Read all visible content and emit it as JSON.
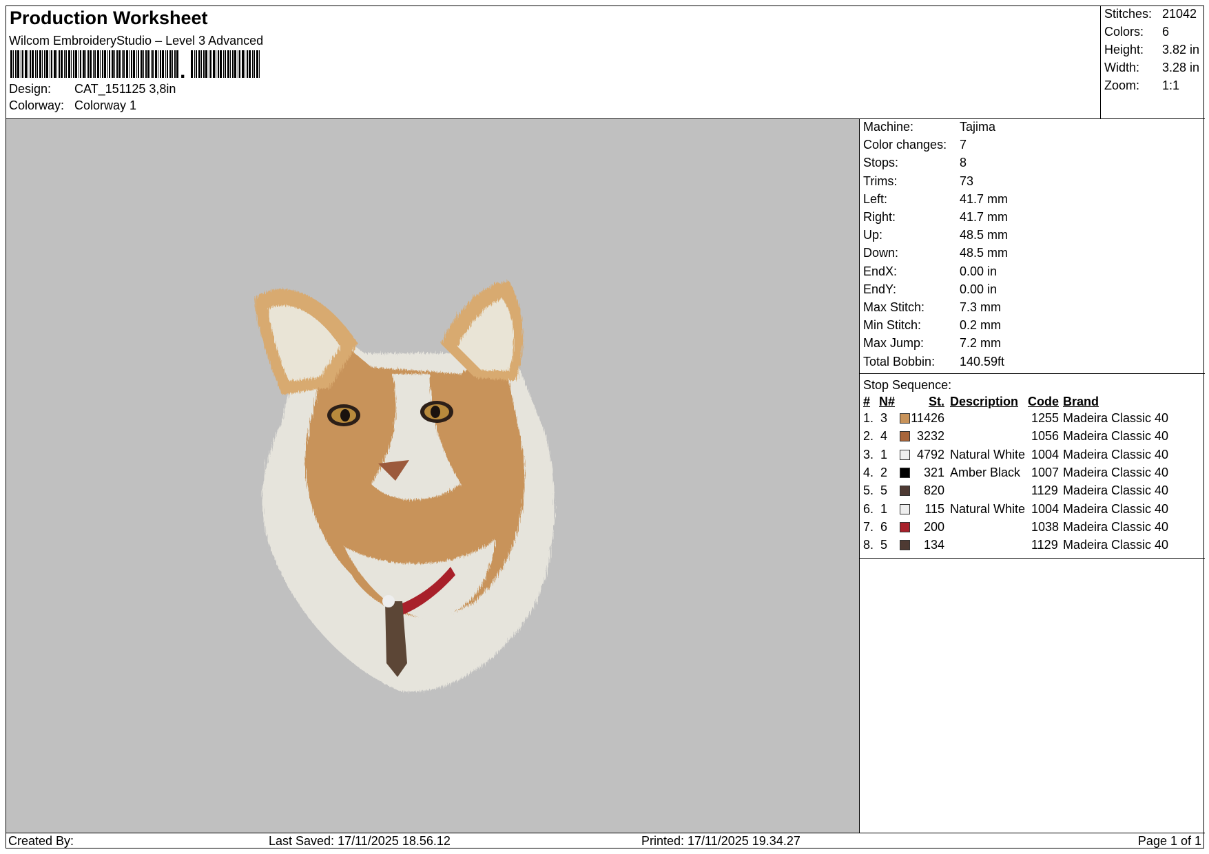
{
  "header": {
    "title": "Production Worksheet",
    "software": "Wilcom EmbroideryStudio – Level 3 Advanced",
    "barcode_text": ",",
    "design_label": "Design:",
    "design_value": "CAT_151125 3,8in",
    "colorway_label": "Colorway:",
    "colorway_value": "Colorway 1"
  },
  "stats": [
    {
      "label": "Stitches:",
      "value": "21042"
    },
    {
      "label": "Colors:",
      "value": "6"
    },
    {
      "label": "Height:",
      "value": "3.82 in"
    },
    {
      "label": "Width:",
      "value": "3.28 in"
    },
    {
      "label": "Zoom:",
      "value": "1:1"
    }
  ],
  "machine_info": [
    {
      "label": "Machine:",
      "value": "Tajima"
    },
    {
      "label": "Color changes:",
      "value": "7"
    },
    {
      "label": "Stops:",
      "value": "8"
    },
    {
      "label": "Trims:",
      "value": "73"
    },
    {
      "label": "Left:",
      "value": "41.7 mm"
    },
    {
      "label": "Right:",
      "value": "41.7 mm"
    },
    {
      "label": "Up:",
      "value": "48.5 mm"
    },
    {
      "label": "Down:",
      "value": "48.5 mm"
    },
    {
      "label": "EndX:",
      "value": "0.00 in"
    },
    {
      "label": "EndY:",
      "value": "0.00 in"
    },
    {
      "label": "Max Stitch:",
      "value": "7.3 mm"
    },
    {
      "label": "Min Stitch:",
      "value": "0.2 mm"
    },
    {
      "label": "Max Jump:",
      "value": "7.2 mm"
    },
    {
      "label": "Total Bobbin:",
      "value": "140.59ft"
    }
  ],
  "stop_sequence": {
    "title": "Stop Sequence:",
    "headers": {
      "num": "#",
      "n": "N#",
      "st": "St.",
      "description": "Description",
      "code": "Code",
      "brand": "Brand"
    },
    "rows": [
      {
        "num": "1.",
        "n": "3",
        "color": "#c8935a",
        "st": "11426",
        "description": "",
        "code": "1255",
        "brand": "Madeira Classic 40"
      },
      {
        "num": "2.",
        "n": "4",
        "color": "#a8653a",
        "st": "3232",
        "description": "",
        "code": "1056",
        "brand": "Madeira Classic 40"
      },
      {
        "num": "3.",
        "n": "1",
        "color": "#eeeeee",
        "st": "4792",
        "description": "Natural White",
        "code": "1004",
        "brand": "Madeira Classic 40"
      },
      {
        "num": "4.",
        "n": "2",
        "color": "#000000",
        "st": "321",
        "description": "Amber Black",
        "code": "1007",
        "brand": "Madeira Classic 40"
      },
      {
        "num": "5.",
        "n": "5",
        "color": "#4e3a33",
        "st": "820",
        "description": "",
        "code": "1129",
        "brand": "Madeira Classic 40"
      },
      {
        "num": "6.",
        "n": "1",
        "color": "#eeeeee",
        "st": "115",
        "description": "Natural White",
        "code": "1004",
        "brand": "Madeira Classic 40"
      },
      {
        "num": "7.",
        "n": "6",
        "color": "#a8202a",
        "st": "200",
        "description": "",
        "code": "1038",
        "brand": "Madeira Classic 40"
      },
      {
        "num": "8.",
        "n": "5",
        "color": "#4e3a33",
        "st": "134",
        "description": "",
        "code": "1129",
        "brand": "Madeira Classic 40"
      }
    ]
  },
  "footer": {
    "created_by": "Created By:",
    "last_saved": "Last Saved: 17/11/2025 18.56.12",
    "printed": "Printed: 17/11/2025 19.34.27",
    "page": "Page 1 of 1"
  },
  "colors": {
    "preview_background": "#c0c0c0",
    "fur_tan": "#c8935a",
    "fur_white": "#e6e4dc"
  }
}
